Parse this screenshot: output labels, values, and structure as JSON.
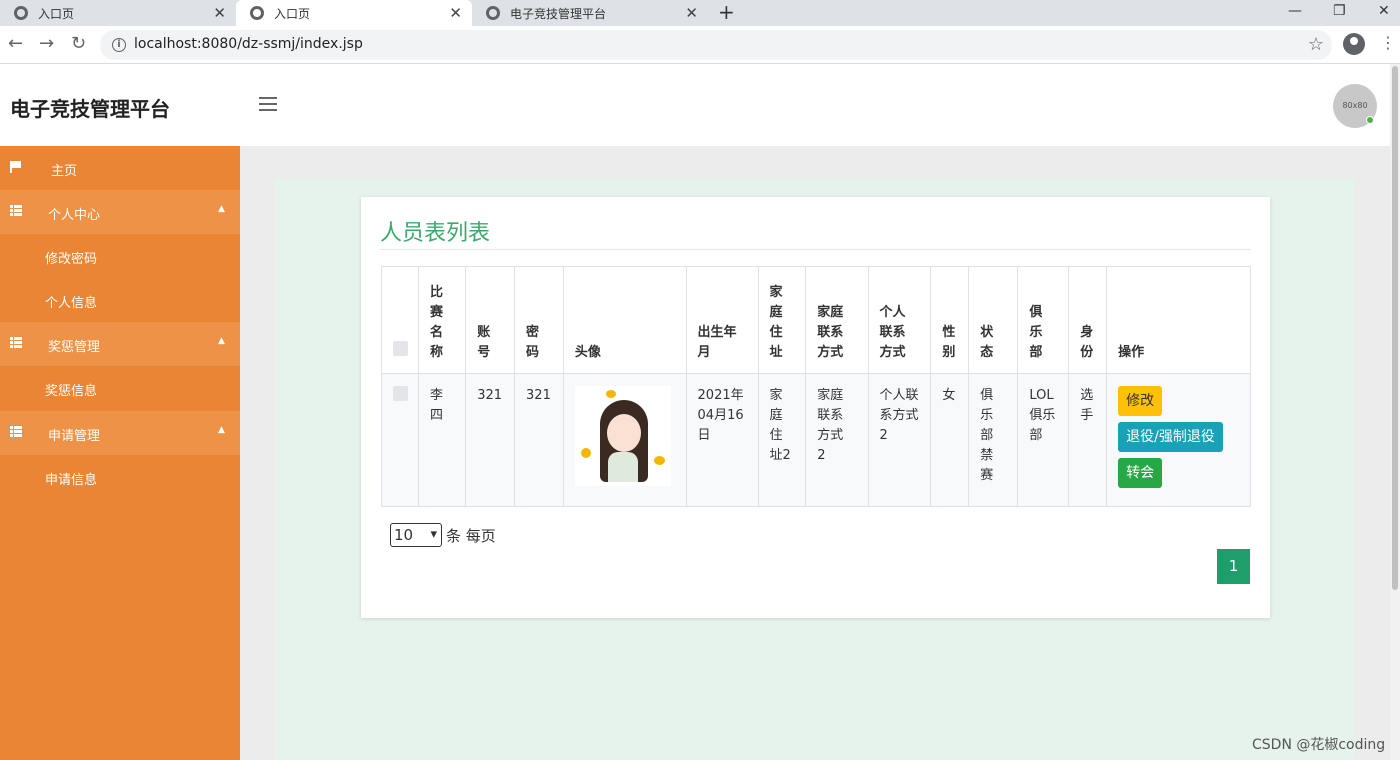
{
  "browser": {
    "tabs": [
      {
        "title": "入口页",
        "close": "✕"
      },
      {
        "title": "入口页",
        "close": "✕"
      },
      {
        "title": "电子竞技管理平台",
        "close": "✕"
      }
    ],
    "new_tab": "+",
    "window_controls": {
      "minimize": "—",
      "restore": "❐",
      "close": "✕"
    },
    "url": "localhost:8080/dz-ssmj/index.jsp",
    "nav": {
      "back": "←",
      "forward": "→",
      "reload": "↻"
    },
    "info_glyph": "i",
    "star": "☆",
    "menu": "⋮"
  },
  "header": {
    "title": "电子竞技管理平台",
    "avatar_text": "80x80"
  },
  "sidebar": {
    "home": "主页",
    "groups": [
      {
        "label": "个人中心",
        "caret": "▲",
        "items": [
          "修改密码",
          "个人信息"
        ]
      },
      {
        "label": "奖惩管理",
        "caret": "▲",
        "items": [
          "奖惩信息"
        ]
      },
      {
        "label": "申请管理",
        "caret": "▲",
        "items": [
          "申请信息"
        ]
      }
    ]
  },
  "main": {
    "title": "人员表列表",
    "columns": [
      "比赛名称",
      "账号",
      "密码",
      "头像",
      "出生年月",
      "家庭住址",
      "家庭联系方式",
      "个人联系方式",
      "性别",
      "状态",
      "俱乐部",
      "身份",
      "操作"
    ],
    "rows": [
      {
        "name": "李四",
        "account": "321",
        "password": "321",
        "birth": "2021年04月16日",
        "address": "家庭住址2",
        "home_contact": "家庭联系方式2",
        "personal_contact": "个人联系方式2",
        "gender": "女",
        "status": "俱乐部禁赛",
        "club": "LOL俱乐部",
        "role": "选手",
        "actions": [
          "修改",
          "退役/强制退役",
          "转会"
        ]
      }
    ],
    "page_size": "10",
    "page_size_suffix": "条 每页",
    "current_page": "1"
  },
  "watermark": "CSDN @花椒coding",
  "colors": {
    "sidebar": "#ea8535",
    "accent_green": "#3aaa6b",
    "page_button": "#1e9e6a"
  }
}
